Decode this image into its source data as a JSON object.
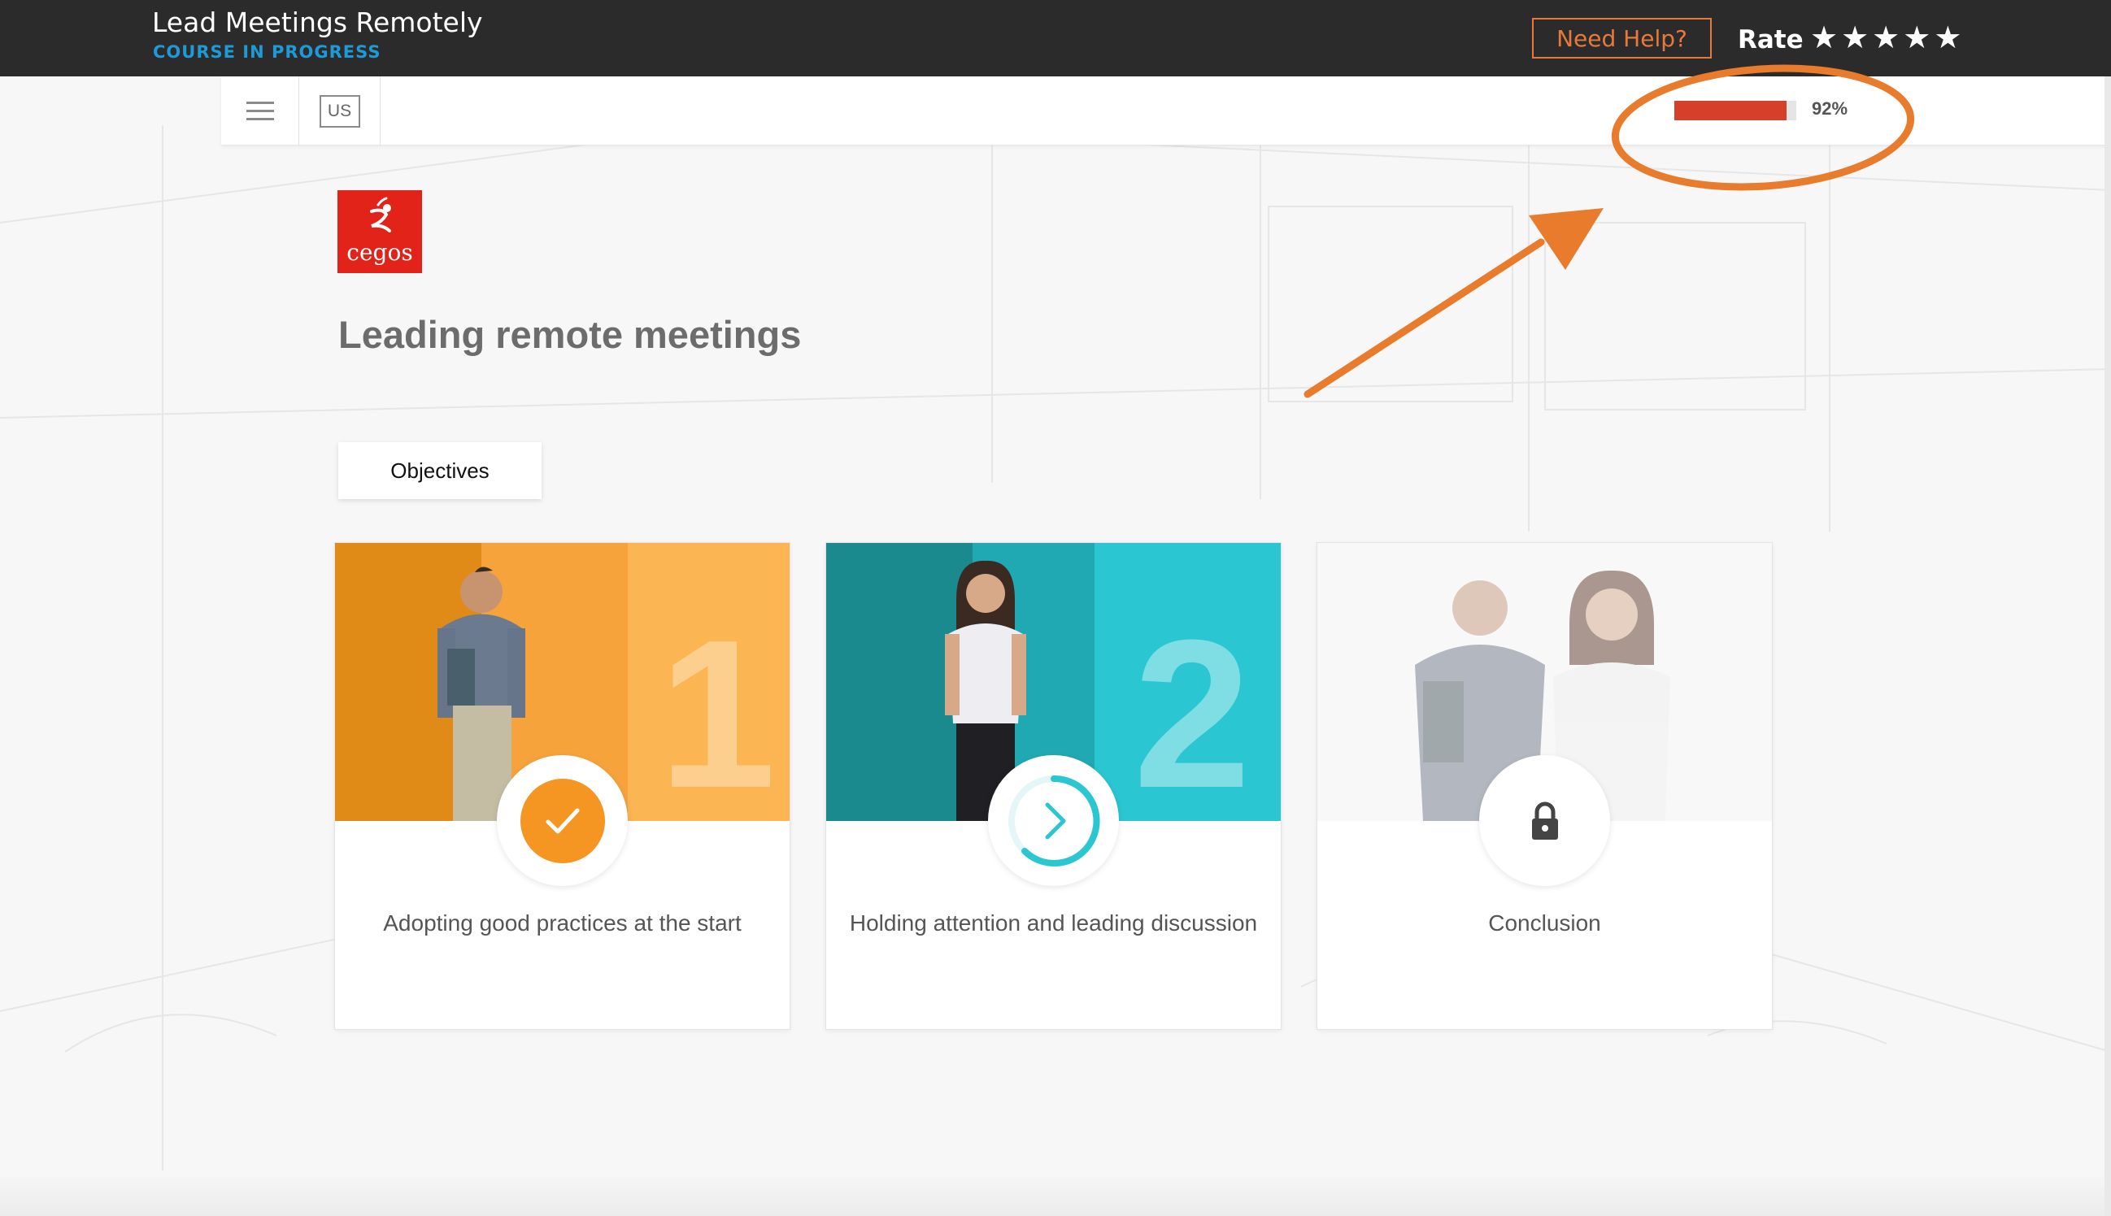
{
  "header": {
    "course_title": "Lead Meetings Remotely",
    "course_status": "COURSE IN PROGRESS",
    "help_label": "Need Help?",
    "rate_label": "Rate",
    "rating_stars": 5,
    "accent_color": "#e8793a"
  },
  "toolbar": {
    "menu_icon": "hamburger-menu-icon",
    "language": "US",
    "progress": {
      "value": 92,
      "label": "92%",
      "color": "#d63f2a"
    }
  },
  "content": {
    "logo_text": "cegos",
    "title": "Leading remote meetings",
    "objectives_label": "Objectives"
  },
  "modules": [
    {
      "number": "1",
      "label": "Adopting good practices at the start",
      "status": "completed",
      "status_icon": "checkmark-icon",
      "color": "#f5a23c"
    },
    {
      "number": "2",
      "label": "Holding attention and leading discussion",
      "status": "in-progress",
      "status_icon": "chevron-right-icon",
      "color": "#27b7c9"
    },
    {
      "number": "",
      "label": "Conclusion",
      "status": "locked",
      "status_icon": "lock-icon",
      "color": "#9a9a9a"
    }
  ],
  "annotation": {
    "color": "#e87b2c",
    "shape": "circle around progress indicator with arrow"
  }
}
